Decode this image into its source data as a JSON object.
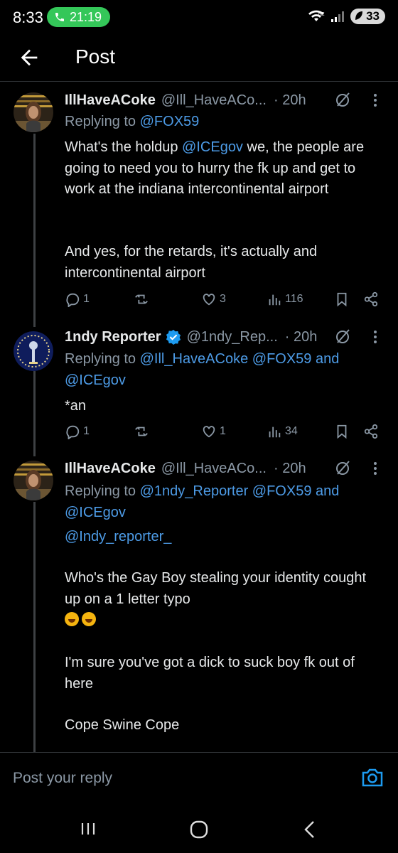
{
  "status_bar": {
    "time": "8:33",
    "call_duration": "21:19",
    "battery": "33",
    "network": "6E"
  },
  "header": {
    "title": "Post",
    "back_icon": "back-arrow-icon"
  },
  "posts": [
    {
      "name": "IllHaveACoke",
      "handle": "@Ill_HaveACo...",
      "time": "· 20h",
      "replying_prefix": "Replying to",
      "replying_to": "@FOX59",
      "text_part1": "What's the holdup",
      "mention": "@ICEgov",
      "text_part2": "we, the people are going to need you to hurry the fk up and get to work at the indiana intercontinental airport",
      "text_part3": "And yes, for the retards, it's actually and intercontinental airport",
      "stats": {
        "replies": "1",
        "reposts": "",
        "likes": "3",
        "views": "116"
      }
    },
    {
      "name": "1ndy Reporter",
      "verified": true,
      "handle": "@1ndy_Rep...",
      "time": "· 20h",
      "replying_prefix": "Replying to",
      "replying_to": "@Ill_HaveACoke @FOX59 and @ICEgov",
      "text": "*an",
      "stats": {
        "replies": "1",
        "reposts": "",
        "likes": "1",
        "views": "34"
      }
    },
    {
      "name": "IllHaveACoke",
      "handle": "@Ill_HaveACo...",
      "time": "· 20h",
      "replying_prefix": "Replying to",
      "replying_to": "@1ndy_Reporter @FOX59 and @ICEgov",
      "mention": "@Indy_reporter_",
      "text_part1": "Who's the Gay Boy stealing your identity cought up on a 1 letter typo",
      "text_part2": "I'm sure you've got a dick to suck boy fk out of here",
      "text_part3": "Cope Swine Cope"
    }
  ],
  "reply_box": {
    "placeholder": "Post your reply"
  },
  "colors": {
    "background": "#000000",
    "link": "#4d9be6",
    "muted": "#8b98a5",
    "verified": "#1d9bf0",
    "call": "#34c759"
  }
}
